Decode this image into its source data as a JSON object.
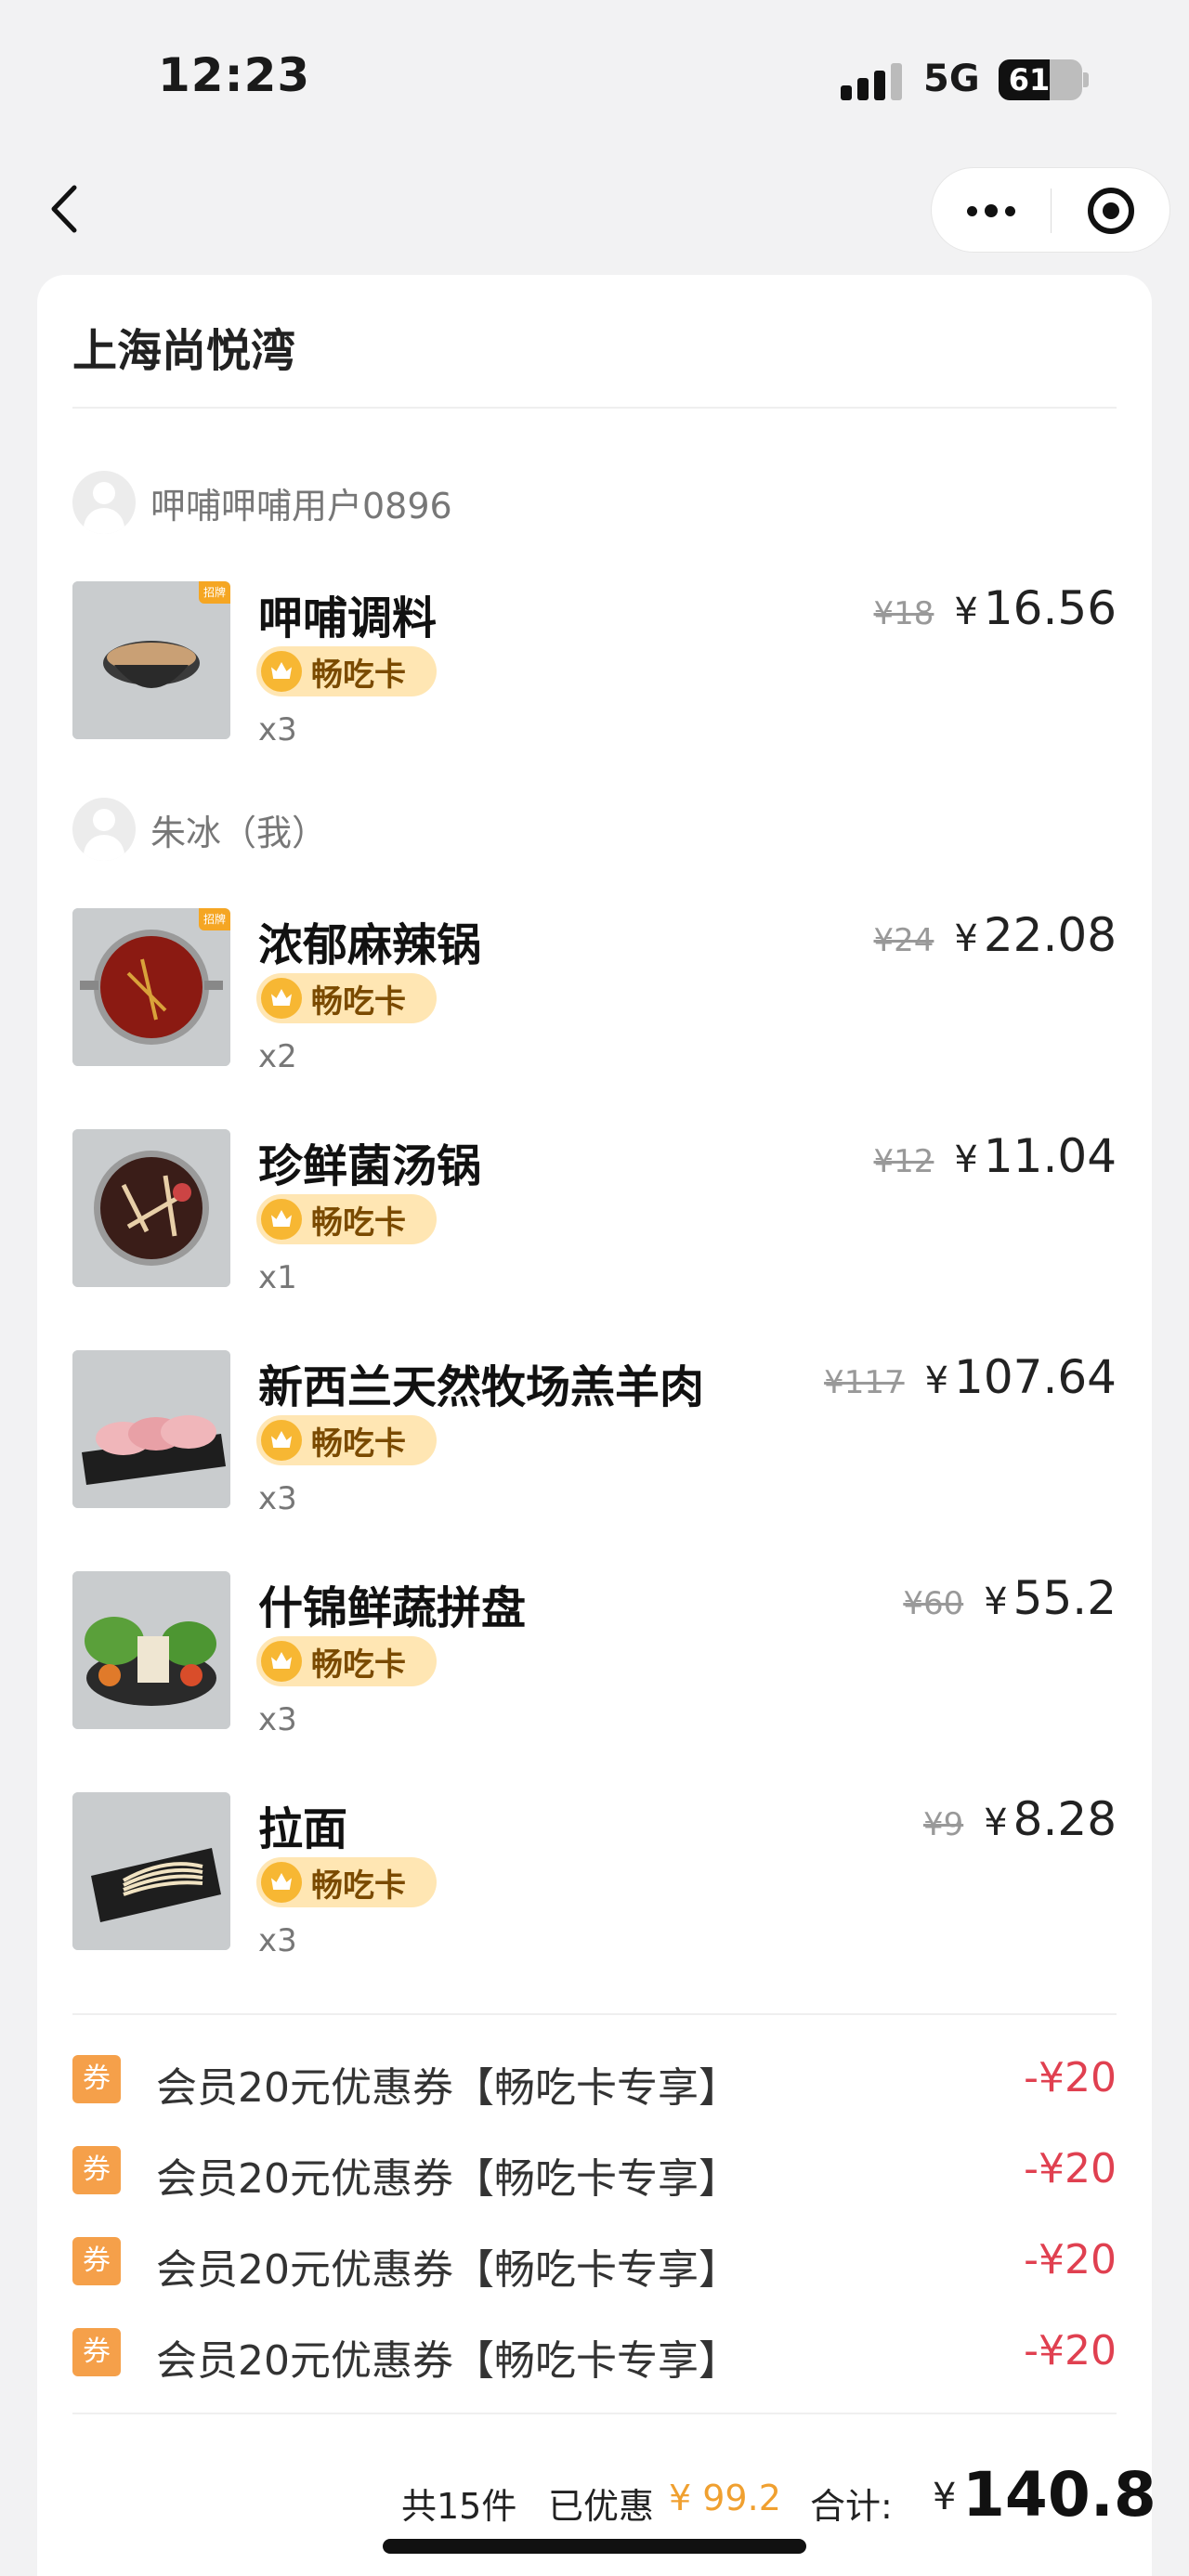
{
  "status": {
    "time": "12:23",
    "network": "5G",
    "battery": "61",
    "battery_level": 0.61
  },
  "store": {
    "name": "上海尚悦湾"
  },
  "groups": [
    {
      "user": "呷哺呷哺用户0896",
      "items": [
        {
          "name": "呷哺调料",
          "badge": "畅吃卡",
          "qty": "x3",
          "orig": "¥18",
          "currency": "¥",
          "price": "16.56",
          "tag": "招牌"
        }
      ]
    },
    {
      "user": "朱冰（我）",
      "items": [
        {
          "name": "浓郁麻辣锅",
          "badge": "畅吃卡",
          "qty": "x2",
          "orig": "¥24",
          "currency": "¥",
          "price": "22.08",
          "tag": "招牌"
        },
        {
          "name": "珍鲜菌汤锅",
          "badge": "畅吃卡",
          "qty": "x1",
          "orig": "¥12",
          "currency": "¥",
          "price": "11.04"
        },
        {
          "name": "新西兰天然牧场羔羊肉",
          "badge": "畅吃卡",
          "qty": "x3",
          "orig": "¥117",
          "currency": "¥",
          "price": "107.64"
        },
        {
          "name": "什锦鲜蔬拼盘",
          "badge": "畅吃卡",
          "qty": "x3",
          "orig": "¥60",
          "currency": "¥",
          "price": "55.2"
        },
        {
          "name": "拉面",
          "badge": "畅吃卡",
          "qty": "x3",
          "orig": "¥9",
          "currency": "¥",
          "price": "8.28"
        }
      ]
    }
  ],
  "coupons": [
    {
      "icon": "券",
      "label": "会员20元优惠券【畅吃卡专享】",
      "amount": "-¥20"
    },
    {
      "icon": "券",
      "label": "会员20元优惠券【畅吃卡专享】",
      "amount": "-¥20"
    },
    {
      "icon": "券",
      "label": "会员20元优惠券【畅吃卡专享】",
      "amount": "-¥20"
    },
    {
      "icon": "券",
      "label": "会员20元优惠券【畅吃卡专享】",
      "amount": "-¥20"
    }
  ],
  "summary": {
    "count": "共15件",
    "discount_label": "已优惠",
    "discount": "¥ 99.2",
    "total_label": "合计:",
    "currency": "¥",
    "total": "140.8"
  },
  "colors": {
    "accent_orange": "#f5a04a",
    "discount_red": "#e04050",
    "badge_bg": "#ffe6b3"
  }
}
